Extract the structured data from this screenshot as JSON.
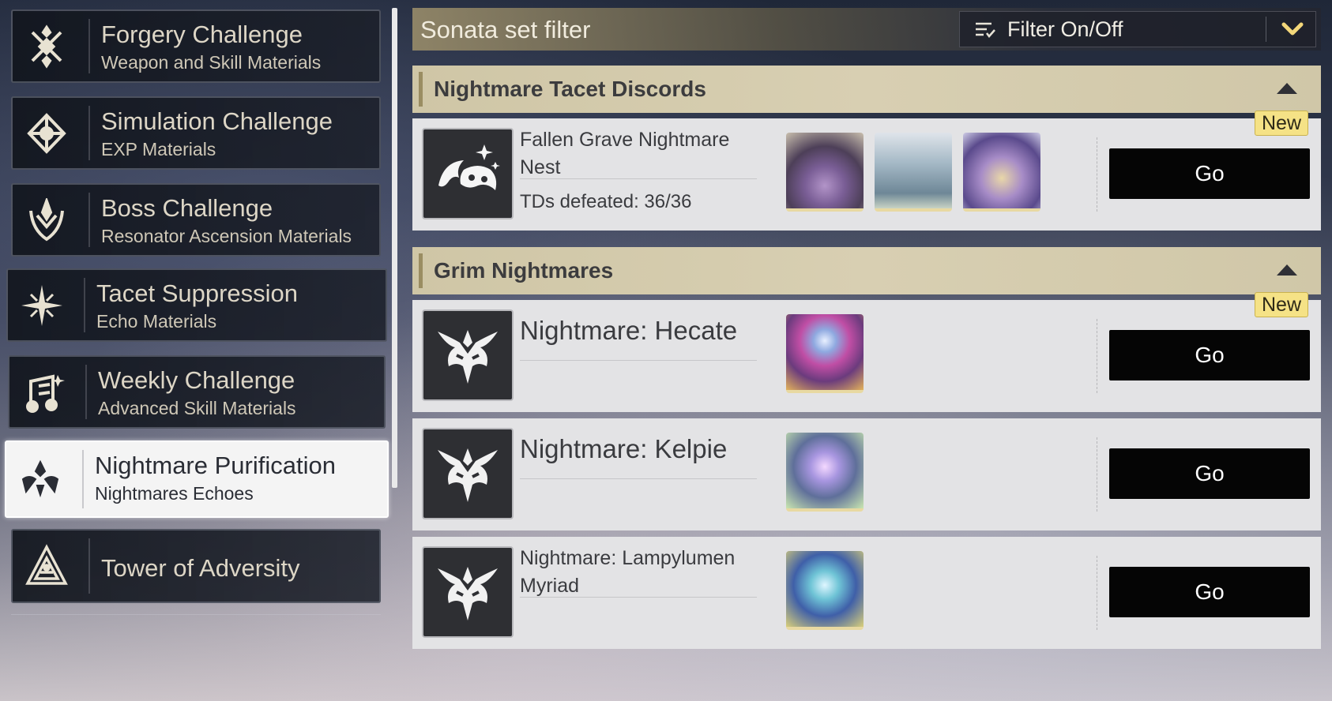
{
  "menu": {
    "items": [
      {
        "title": "Forgery Challenge",
        "subtitle": "Weapon and Skill Materials",
        "icon": "forgery-icon"
      },
      {
        "title": "Simulation Challenge",
        "subtitle": "EXP Materials",
        "icon": "simulation-icon"
      },
      {
        "title": "Boss Challenge",
        "subtitle": "Resonator Ascension Materials",
        "icon": "boss-icon"
      },
      {
        "title": "Tacet Suppression",
        "subtitle": "Echo Materials",
        "icon": "tacet-star-icon"
      },
      {
        "title": "Weekly Challenge",
        "subtitle": "Advanced Skill Materials",
        "icon": "weekly-icon"
      },
      {
        "title": "Nightmare Purification",
        "subtitle": "Nightmares Echoes",
        "icon": "nightmare-icon",
        "active": true
      },
      {
        "title": "Tower of Adversity",
        "subtitle": "",
        "icon": "tower-icon"
      }
    ]
  },
  "filter": {
    "title": "Sonata set filter",
    "toggle_label": "Filter On/Off"
  },
  "sections": {
    "tacet": {
      "header": "Nightmare Tacet Discords",
      "card": {
        "name": "Fallen Grave Nightmare Nest",
        "progress": "TDs defeated: 36/36",
        "badge": "New",
        "go": "Go"
      }
    },
    "grim": {
      "header": "Grim Nightmares",
      "cards": [
        {
          "name": "Nightmare: Hecate",
          "badge": "New",
          "go": "Go"
        },
        {
          "name": "Nightmare: Kelpie",
          "go": "Go"
        },
        {
          "name": "Nightmare: Lampylumen Myriad",
          "go": "Go"
        }
      ]
    }
  },
  "colors": {
    "accent_gold": "#cfc6a6",
    "badge_yellow": "#f5e286",
    "go_button": "#050505"
  }
}
